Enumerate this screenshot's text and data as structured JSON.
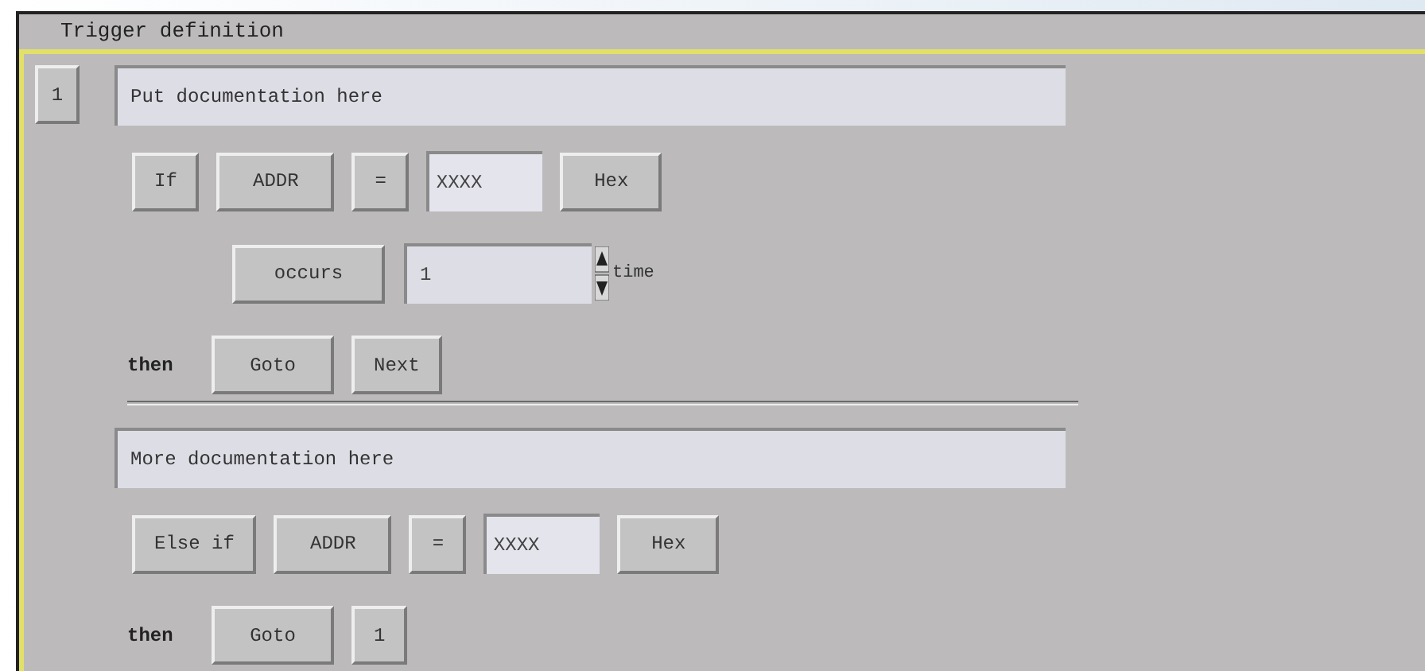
{
  "title": "Trigger definition",
  "steps": [
    {
      "number": "1",
      "documentation": "Put documentation here",
      "condition": {
        "keyword": "If",
        "operand": "ADDR",
        "operator": "=",
        "value": "XXXX",
        "base": "Hex"
      },
      "occurs": {
        "label": "occurs",
        "count": "1",
        "unit": "time"
      },
      "action": {
        "then": "then",
        "verb": "Goto",
        "target": "Next"
      }
    },
    {
      "documentation": "More documentation here",
      "condition": {
        "keyword": "Else if",
        "operand": "ADDR",
        "operator": "=",
        "value": "XXXX",
        "base": "Hex"
      },
      "action": {
        "then": "then",
        "verb": "Goto",
        "target": "1"
      }
    }
  ]
}
